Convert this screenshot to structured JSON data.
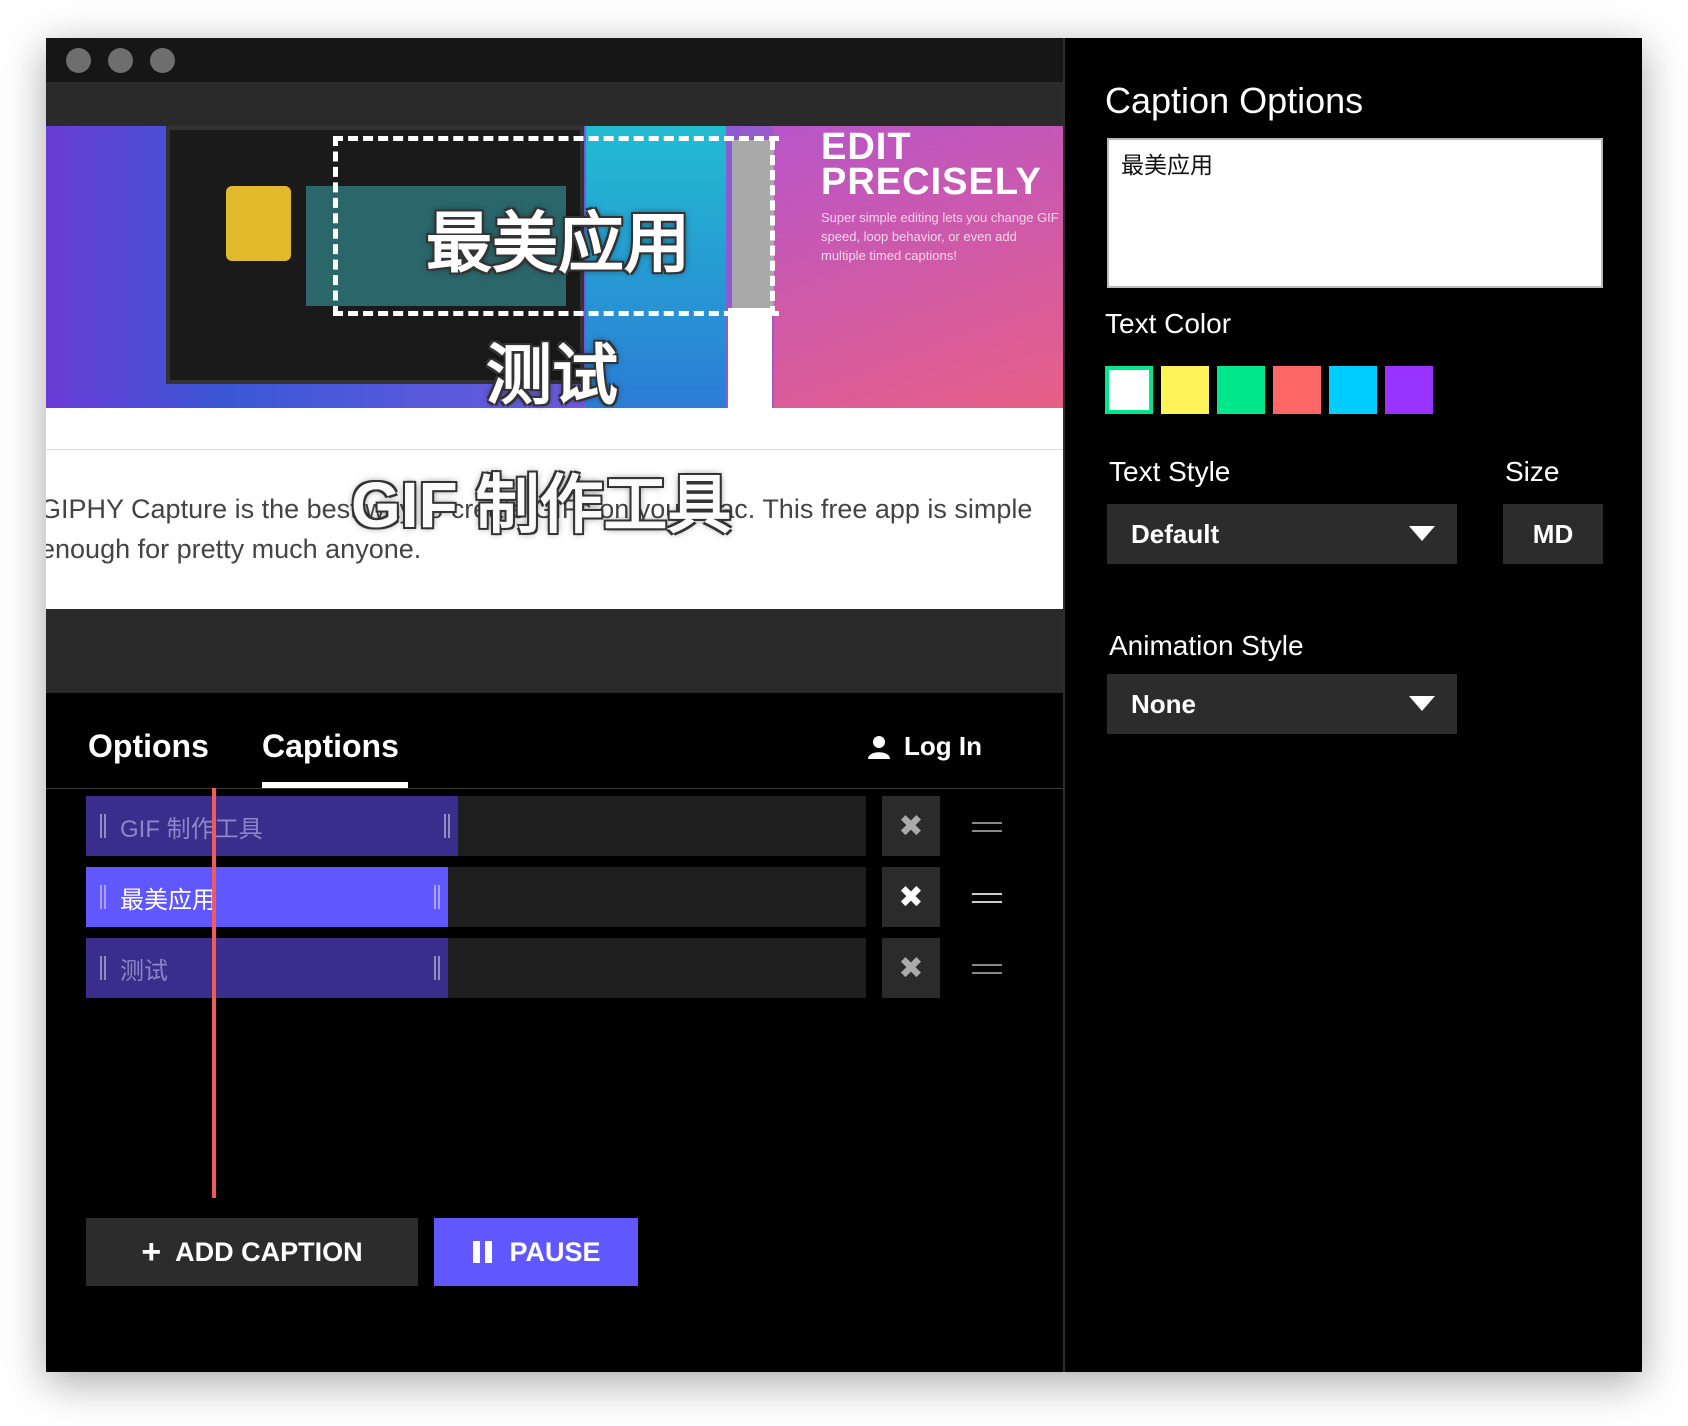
{
  "preview": {
    "caption_top": "最美应用",
    "caption_mid": "测试",
    "caption_bottom": "GIF 制作工具",
    "banner_title": "EDIT\nPRECISELY",
    "banner_sub": "Super simple editing lets you change GIF speed, loop behavior, or even add multiple timed captions!",
    "article_text": "GIPHY Capture is the best way to create GIFs on your Mac. This free app is simple enough for pretty much anyone."
  },
  "tabs": [
    {
      "label": "Options"
    },
    {
      "label": "Captions",
      "active": true
    }
  ],
  "login_label": "Log In",
  "captions": [
    {
      "label": "GIF 制作工具",
      "state": "inactive"
    },
    {
      "label": "最美应用",
      "state": "active"
    },
    {
      "label": "测试",
      "state": "inactive"
    }
  ],
  "buttons": {
    "add_caption": "ADD CAPTION",
    "pause": "PAUSE"
  },
  "caption_options": {
    "title": "Caption Options",
    "text_value": "最美应用",
    "text_color_label": "Text Color",
    "colors": [
      "#ffffff",
      "#fff35c",
      "#00e68a",
      "#ff6666",
      "#00ccff",
      "#9933ff"
    ],
    "selected_color": "#ffffff",
    "text_style_label": "Text Style",
    "text_style_value": "Default",
    "size_label": "Size",
    "size_value": "MD",
    "animation_label": "Animation Style",
    "animation_value": "None"
  },
  "colors": {
    "accent": "#6157ff",
    "accent_dim": "#3a2d8c",
    "playhead": "#f05a5a"
  }
}
